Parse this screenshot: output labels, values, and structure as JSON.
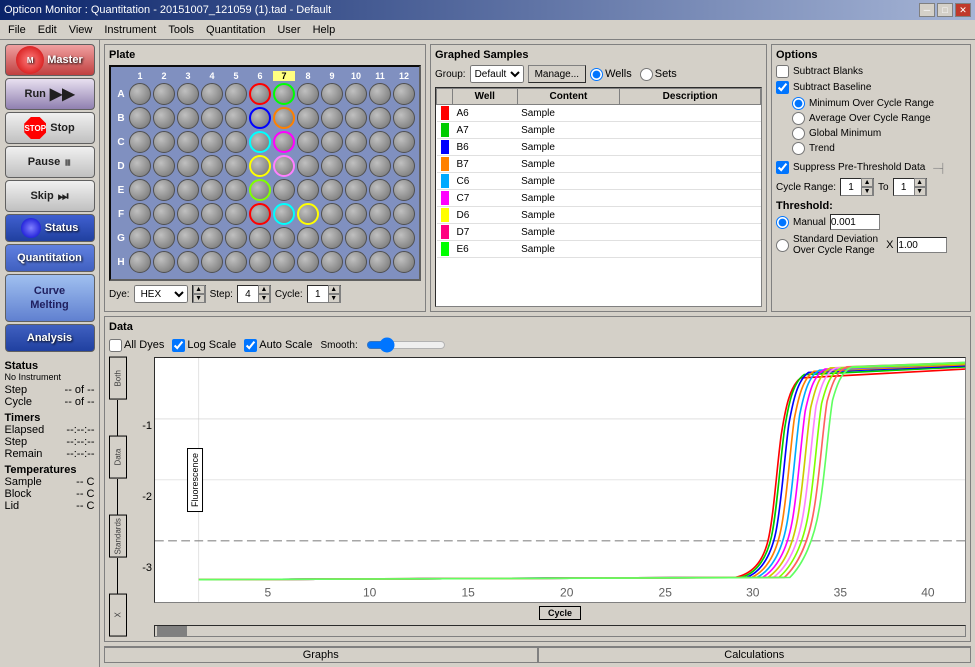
{
  "titlebar": {
    "title": "Opticon Monitor : Quantitation - 20151007_121059 (1).tad - Default",
    "minimize": "─",
    "maximize": "□",
    "close": "✕"
  },
  "menubar": {
    "items": [
      "File",
      "Edit",
      "View",
      "Instrument",
      "Tools",
      "Quantitation",
      "User",
      "Help"
    ]
  },
  "sidebar": {
    "buttons": [
      {
        "id": "master",
        "label": "Master"
      },
      {
        "id": "run",
        "label": "Run"
      },
      {
        "id": "stop",
        "label": "Stop"
      },
      {
        "id": "pause",
        "label": "Pause"
      },
      {
        "id": "skip",
        "label": "Skip"
      },
      {
        "id": "status",
        "label": "Status"
      },
      {
        "id": "quantitation",
        "label": "Quantitation"
      },
      {
        "id": "melting",
        "label": "Melting\nCurve"
      },
      {
        "id": "analysis",
        "label": "Analysis"
      }
    ],
    "status_section": {
      "title": "Status",
      "instrument": "No Instrument",
      "step_label": "Step",
      "step_value": "-- of --",
      "cycle_label": "Cycle",
      "cycle_value": "-- of --",
      "timers_title": "Timers",
      "elapsed_label": "Elapsed",
      "elapsed_value": "--:--:--",
      "step_time_label": "Step",
      "step_time_value": "--:--:--",
      "remain_label": "Remain",
      "remain_value": "--:--:--",
      "temps_title": "Temperatures",
      "sample_label": "Sample",
      "sample_value": "-- C",
      "block_label": "Block",
      "block_value": "-- C",
      "lid_label": "Lid",
      "lid_value": "-- C"
    }
  },
  "plate": {
    "title": "Plate",
    "col_headers": [
      "1",
      "2",
      "3",
      "4",
      "5",
      "6",
      "7",
      "8",
      "9",
      "10",
      "11",
      "12"
    ],
    "row_headers": [
      "A",
      "B",
      "C",
      "D",
      "E",
      "F",
      "G",
      "H"
    ],
    "dye_label": "Dye:",
    "dye_value": "HEX",
    "step_label": "Step:",
    "step_value": "4",
    "cycle_label": "Cycle:",
    "cycle_value": "1"
  },
  "graphed_samples": {
    "title": "Graphed Samples",
    "group_label": "Group:",
    "group_value": "Default",
    "manage_label": "Manage...",
    "wells_label": "Wells",
    "sets_label": "Sets",
    "table": {
      "headers": [
        "Well",
        "Content",
        "Description"
      ],
      "rows": [
        {
          "color": "#ff0000",
          "well": "A6",
          "content": "Sample",
          "description": ""
        },
        {
          "color": "#00cc00",
          "well": "A7",
          "content": "Sample",
          "description": ""
        },
        {
          "color": "#0000ff",
          "well": "B6",
          "content": "Sample",
          "description": ""
        },
        {
          "color": "#ff8000",
          "well": "B7",
          "content": "Sample",
          "description": ""
        },
        {
          "color": "#00aaff",
          "well": "C6",
          "content": "Sample",
          "description": ""
        },
        {
          "color": "#ff00ff",
          "well": "C7",
          "content": "Sample",
          "description": ""
        },
        {
          "color": "#ffff00",
          "well": "D6",
          "content": "Sample",
          "description": ""
        },
        {
          "color": "#ff0080",
          "well": "D7",
          "content": "Sample",
          "description": ""
        },
        {
          "color": "#00ff00",
          "well": "E6",
          "content": "Sample",
          "description": ""
        }
      ]
    }
  },
  "options": {
    "title": "Options",
    "subtract_blanks_label": "Subtract Blanks",
    "subtract_blanks_checked": false,
    "subtract_baseline_label": "Subtract Baseline",
    "subtract_baseline_checked": true,
    "baseline_options": [
      {
        "label": "Minimum Over Cycle Range",
        "checked": true
      },
      {
        "label": "Average Over Cycle Range",
        "checked": false
      },
      {
        "label": "Global Minimum",
        "checked": false
      },
      {
        "label": "Trend",
        "checked": false
      }
    ],
    "suppress_label": "Suppress Pre-Threshold Data",
    "suppress_checked": true,
    "cycle_range_label": "Cycle Range:",
    "cycle_from": "1",
    "cycle_to_label": "To",
    "cycle_to": "1",
    "threshold_title": "Threshold:",
    "manual_label": "Manual",
    "manual_value": "0.001",
    "std_dev_label": "Standard Deviation Over Cycle Range",
    "std_dev_value": "1.00"
  },
  "data": {
    "title": "Data",
    "all_dyes_label": "All Dyes",
    "log_scale_label": "Log Scale",
    "log_scale_checked": true,
    "auto_scale_label": "Auto Scale",
    "auto_scale_checked": true,
    "smooth_label": "Smooth:",
    "y_axis_label": "Fluorescence",
    "x_axis_label": "Cycle",
    "y_ticks": [
      "-1",
      "-2",
      "-3"
    ],
    "x_ticks": [
      "5",
      "10",
      "15",
      "20",
      "25",
      "30",
      "35",
      "40"
    ],
    "vert_labels": [
      "Both",
      "Data",
      "Standards"
    ],
    "threshold_line_y": "-3"
  },
  "bottom_tabs": {
    "graphs_label": "Graphs",
    "calculations_label": "Calculations"
  }
}
